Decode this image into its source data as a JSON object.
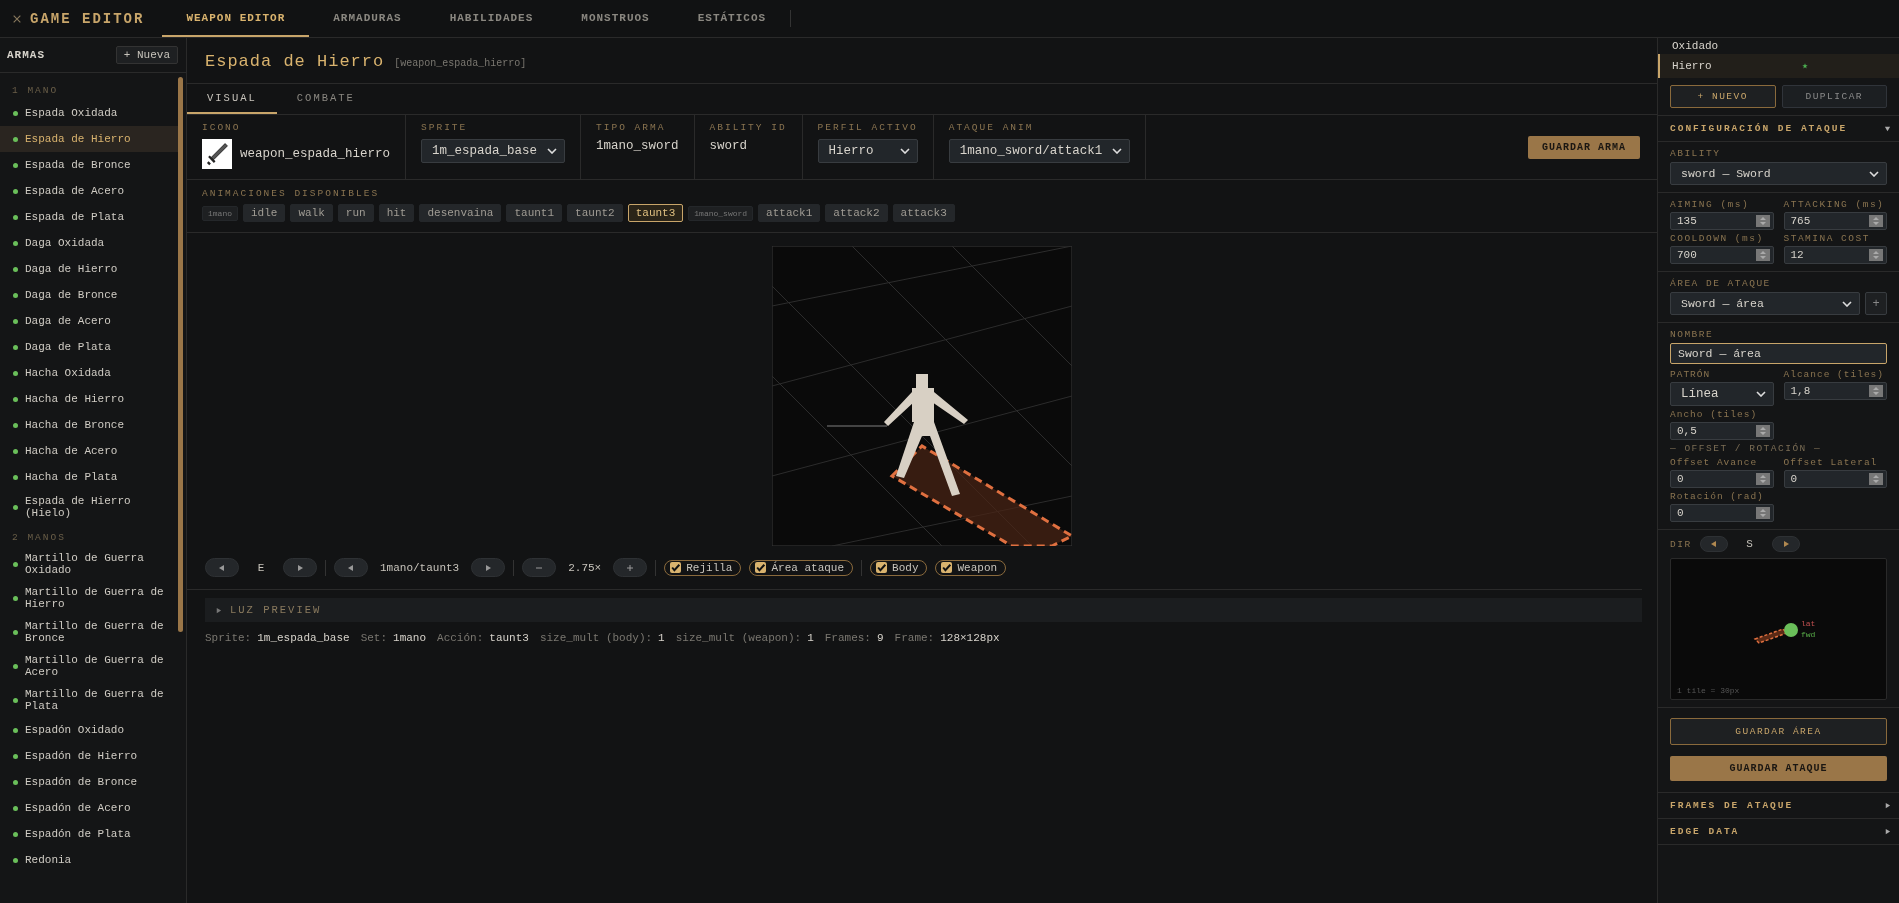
{
  "app": {
    "title": "GAME EDITOR"
  },
  "nav": [
    {
      "label": "WEAPON EDITOR",
      "selected": true
    },
    {
      "label": "ARMADURAS",
      "selected": false
    },
    {
      "label": "HABILIDADES",
      "selected": false
    },
    {
      "label": "MONSTRUOS",
      "selected": false
    },
    {
      "label": "ESTÁTICOS",
      "selected": false
    }
  ],
  "sidebar": {
    "title": "ARMAS",
    "new_button": "+ Nueva",
    "groups": [
      {
        "label": "1 MANO",
        "items": [
          {
            "name": "Espada Oxidada",
            "selected": false
          },
          {
            "name": "Espada de Hierro",
            "selected": true
          },
          {
            "name": "Espada de Bronce",
            "selected": false
          },
          {
            "name": "Espada de Acero",
            "selected": false
          },
          {
            "name": "Espada de Plata",
            "selected": false
          },
          {
            "name": "Daga Oxidada",
            "selected": false
          },
          {
            "name": "Daga de Hierro",
            "selected": false
          },
          {
            "name": "Daga de Bronce",
            "selected": false
          },
          {
            "name": "Daga de Acero",
            "selected": false
          },
          {
            "name": "Daga de Plata",
            "selected": false
          },
          {
            "name": "Hacha Oxidada",
            "selected": false
          },
          {
            "name": "Hacha de Hierro",
            "selected": false
          },
          {
            "name": "Hacha de Bronce",
            "selected": false
          },
          {
            "name": "Hacha de Acero",
            "selected": false
          },
          {
            "name": "Hacha de Plata",
            "selected": false
          },
          {
            "name": "Espada de Hierro (Hielo)",
            "selected": false
          }
        ]
      },
      {
        "label": "2 MANOS",
        "items": [
          {
            "name": "Martillo de Guerra Oxidado",
            "selected": false
          },
          {
            "name": "Martillo de Guerra de Hierro",
            "selected": false
          },
          {
            "name": "Martillo de Guerra de Bronce",
            "selected": false
          },
          {
            "name": "Martillo de Guerra de Acero",
            "selected": false
          },
          {
            "name": "Martillo de Guerra de Plata",
            "selected": false
          },
          {
            "name": "Espadón Oxidado",
            "selected": false
          },
          {
            "name": "Espadón de Hierro",
            "selected": false
          },
          {
            "name": "Espadón de Bronce",
            "selected": false
          },
          {
            "name": "Espadón de Acero",
            "selected": false
          },
          {
            "name": "Espadón de Plata",
            "selected": false
          },
          {
            "name": "Redonia",
            "selected": false
          }
        ]
      }
    ]
  },
  "weapon": {
    "name": "Espada de Hierro",
    "id": "[weapon_espada_hierro]"
  },
  "tabs": [
    {
      "label": "VISUAL",
      "selected": true
    },
    {
      "label": "COMBATE",
      "selected": false
    }
  ],
  "fields": [
    {
      "kind": "icon",
      "label": "ICONO",
      "value": "weapon_espada_hierro"
    },
    {
      "kind": "select",
      "label": "SPRITE",
      "value": "1m_espada_base"
    },
    {
      "kind": "text",
      "label": "TIPO ARMA",
      "value": "1mano_sword"
    },
    {
      "kind": "text",
      "label": "ABILITY ID",
      "value": "sword"
    },
    {
      "kind": "select",
      "label": "PERFIL ACTIVO",
      "value": "Hierro"
    },
    {
      "kind": "select",
      "label": "ATAQUE ANIM",
      "value": "1mano_sword/attack1"
    }
  ],
  "save_weapon": "GUARDAR ARMA",
  "animations": {
    "label": "ANIMACIONES DISPONIBLES",
    "chips": [
      {
        "label": "1mano",
        "kind": "group",
        "selected": false
      },
      {
        "label": "idle",
        "kind": "anim",
        "selected": false
      },
      {
        "label": "walk",
        "kind": "anim",
        "selected": false
      },
      {
        "label": "run",
        "kind": "anim",
        "selected": false
      },
      {
        "label": "hit",
        "kind": "anim",
        "selected": false
      },
      {
        "label": "desenvaina",
        "kind": "anim",
        "selected": false
      },
      {
        "label": "taunt1",
        "kind": "anim",
        "selected": false
      },
      {
        "label": "taunt2",
        "kind": "anim",
        "selected": false
      },
      {
        "label": "taunt3",
        "kind": "anim",
        "selected": true
      },
      {
        "label": "1mano_sword",
        "kind": "group",
        "selected": false
      },
      {
        "label": "attack1",
        "kind": "anim",
        "selected": false
      },
      {
        "label": "attack2",
        "kind": "anim",
        "selected": false
      },
      {
        "label": "attack3",
        "kind": "anim",
        "selected": false
      }
    ]
  },
  "controls": {
    "direction": "E",
    "animation": "1mano/taunt3",
    "zoom": "2.75×",
    "toggle_groups": [
      [
        {
          "label": "Rejilla",
          "checked": true
        },
        {
          "label": "Área ataque",
          "checked": true
        }
      ],
      [
        {
          "label": "Body",
          "checked": true
        },
        {
          "label": "Weapon",
          "checked": true
        }
      ]
    ]
  },
  "light_preview": {
    "label": "LUZ PREVIEW",
    "expanded": false
  },
  "info": [
    {
      "label": "Sprite:",
      "value": "1m_espada_base"
    },
    {
      "label": "Set:",
      "value": "1mano"
    },
    {
      "label": "Acción:",
      "value": "taunt3"
    },
    {
      "label": "size_mult (body):",
      "value": "1"
    },
    {
      "label": "size_mult (weapon):",
      "value": "1"
    },
    {
      "label": "Frames:",
      "value": "9"
    },
    {
      "label": "Frame:",
      "value": "128×128px"
    }
  ],
  "profiles": {
    "items": [
      {
        "name": "Oxidado",
        "selected": false,
        "default": false
      },
      {
        "name": "Hierro",
        "selected": true,
        "default": true
      }
    ],
    "new_button": "+ NUEVO",
    "duplicate_button": {
      "label": "DUPLICAR",
      "disabled": true
    }
  },
  "attack_config": {
    "title": "CONFIGURACIÓN DE ATAQUE",
    "expanded": true,
    "ability": {
      "label": "ABILITY",
      "value": "sword — Sword"
    },
    "timings": [
      {
        "label": "AIMING (ms)",
        "value": "135"
      },
      {
        "label": "ATTACKING (ms)",
        "value": "765"
      },
      {
        "label": "COOLDOWN (ms)",
        "value": "700"
      },
      {
        "label": "STAMINA COST",
        "value": "12"
      }
    ],
    "area": {
      "label": "ÁREA DE ATAQUE",
      "value": "Sword — área",
      "add_button": "+"
    },
    "name": {
      "label": "NOMBRE",
      "value": "Sword — área"
    },
    "pattern": {
      "label": "PATRÓN",
      "value": "Línea"
    },
    "range": {
      "label": "Alcance (tiles)",
      "value": "1,8"
    },
    "width": {
      "label": "Ancho (tiles)",
      "value": "0,5"
    },
    "offset_heading": "— OFFSET / ROTACIÓN —",
    "offset_forward": {
      "label": "Offset Avance",
      "value": "0"
    },
    "offset_lateral": {
      "label": "Offset Lateral",
      "value": "0"
    },
    "rotation": {
      "label": "Rotación (rad)",
      "value": "0"
    },
    "dir": {
      "label": "DIR",
      "value": "S"
    },
    "preview": {
      "lat": "lat",
      "fwd": "fwd",
      "scale": "1 tile = 30px"
    },
    "save_area": "GUARDAR ÁREA",
    "save_attack": "GUARDAR ATAQUE"
  },
  "sections": [
    {
      "title": "FRAMES DE ATAQUE",
      "expanded": false
    },
    {
      "title": "EDGE DATA",
      "expanded": false
    }
  ]
}
